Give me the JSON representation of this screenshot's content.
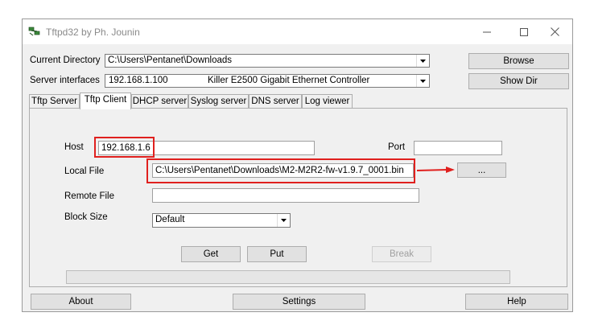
{
  "window": {
    "title": "Tftpd32 by Ph. Jounin",
    "controls": {
      "minimize": "—",
      "maximize": "☐",
      "close": "✕"
    }
  },
  "top": {
    "current_directory_label": "Current Directory",
    "current_directory_value": "C:\\Users\\Pentanet\\Downloads",
    "server_interfaces_label": "Server interfaces",
    "server_interfaces_ip": "192.168.1.100",
    "server_interfaces_adapter": "Killer E2500 Gigabit Ethernet Controller",
    "browse_label": "Browse",
    "show_dir_label": "Show Dir"
  },
  "tabs": [
    {
      "label": "Tftp Server",
      "active": false
    },
    {
      "label": "Tftp Client",
      "active": true
    },
    {
      "label": "DHCP server",
      "active": false
    },
    {
      "label": "Syslog server",
      "active": false
    },
    {
      "label": "DNS server",
      "active": false
    },
    {
      "label": "Log viewer",
      "active": false
    }
  ],
  "client": {
    "host_label": "Host",
    "host_value": "192.168.1.6",
    "port_label": "Port",
    "port_value": "",
    "local_file_label": "Local File",
    "local_file_value": "C:\\Users\\Pentanet\\Downloads\\M2-M2R2-fw-v1.9.7_0001.bin",
    "browse_dots_label": "...",
    "remote_file_label": "Remote File",
    "remote_file_value": "",
    "block_size_label": "Block Size",
    "block_size_value": "Default",
    "get_label": "Get",
    "put_label": "Put",
    "break_label": "Break"
  },
  "bottom": {
    "about_label": "About",
    "settings_label": "Settings",
    "help_label": "Help"
  },
  "annotations": {
    "highlight_color": "#e0201e"
  }
}
